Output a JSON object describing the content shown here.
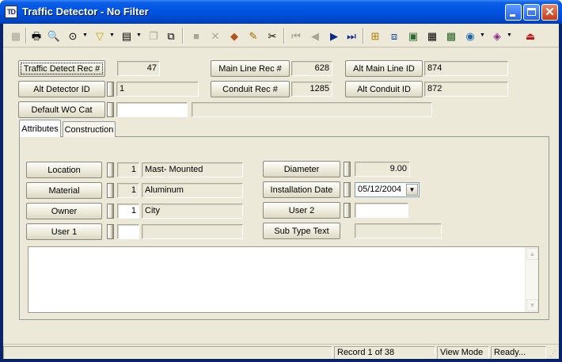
{
  "window": {
    "title": "Traffic Detector - No Filter",
    "app_icon_text": "TD"
  },
  "toolbar": {
    "icons": [
      "grid-icon",
      "print-icon",
      "print-preview-icon",
      "binoculars-icon",
      "filter-icon",
      "new-record-icon",
      "copy-icon",
      "paste-icon",
      "save-icon",
      "delete-icon",
      "spatial-icon",
      "edit-icon",
      "cut-icon",
      "first-record-icon",
      "previous-record-icon",
      "next-record-icon",
      "last-record-icon",
      "hierarchy-icon",
      "relate-icon",
      "map-icon",
      "calculator-icon",
      "map-view-icon",
      "globe-icon",
      "books-icon",
      "exit-icon"
    ]
  },
  "header_fields": {
    "traffic_detect_rec": {
      "label": "Traffic Detect Rec #",
      "value": "47"
    },
    "main_line_rec": {
      "label": "Main Line Rec #",
      "value": "628"
    },
    "alt_main_line_id": {
      "label": "Alt Main Line ID",
      "value": "874"
    },
    "alt_detector_id": {
      "label": "Alt Detector ID",
      "value": "1"
    },
    "conduit_rec": {
      "label": "Conduit Rec #",
      "value": "1285"
    },
    "alt_conduit_id": {
      "label": "Alt Conduit ID",
      "value": "872"
    },
    "default_wo_cat": {
      "label": "Default WO Cat",
      "value": "",
      "description": ""
    }
  },
  "tabs": [
    {
      "label": "Attributes",
      "active": true
    },
    {
      "label": "Construction",
      "active": false
    }
  ],
  "attributes": {
    "location": {
      "label": "Location",
      "code": "1",
      "text": "Mast- Mounted"
    },
    "material": {
      "label": "Material",
      "code": "1",
      "text": "Aluminum"
    },
    "owner": {
      "label": "Owner",
      "code": "1",
      "text": "City"
    },
    "user1": {
      "label": "User 1",
      "code": "",
      "text": ""
    },
    "diameter": {
      "label": "Diameter",
      "value": "9.00"
    },
    "installation_date": {
      "label": "Installation Date",
      "value": "05/12/2004"
    },
    "user2": {
      "label": "User 2",
      "value": ""
    },
    "sub_type_text": {
      "label": "Sub Type Text",
      "value": ""
    }
  },
  "memo": {
    "value": ""
  },
  "status": {
    "record": "Record 1 of 38",
    "mode": "View Mode",
    "state": "Ready..."
  },
  "colors": {
    "titlebar": "#0053e1",
    "face": "#ece9d8"
  }
}
